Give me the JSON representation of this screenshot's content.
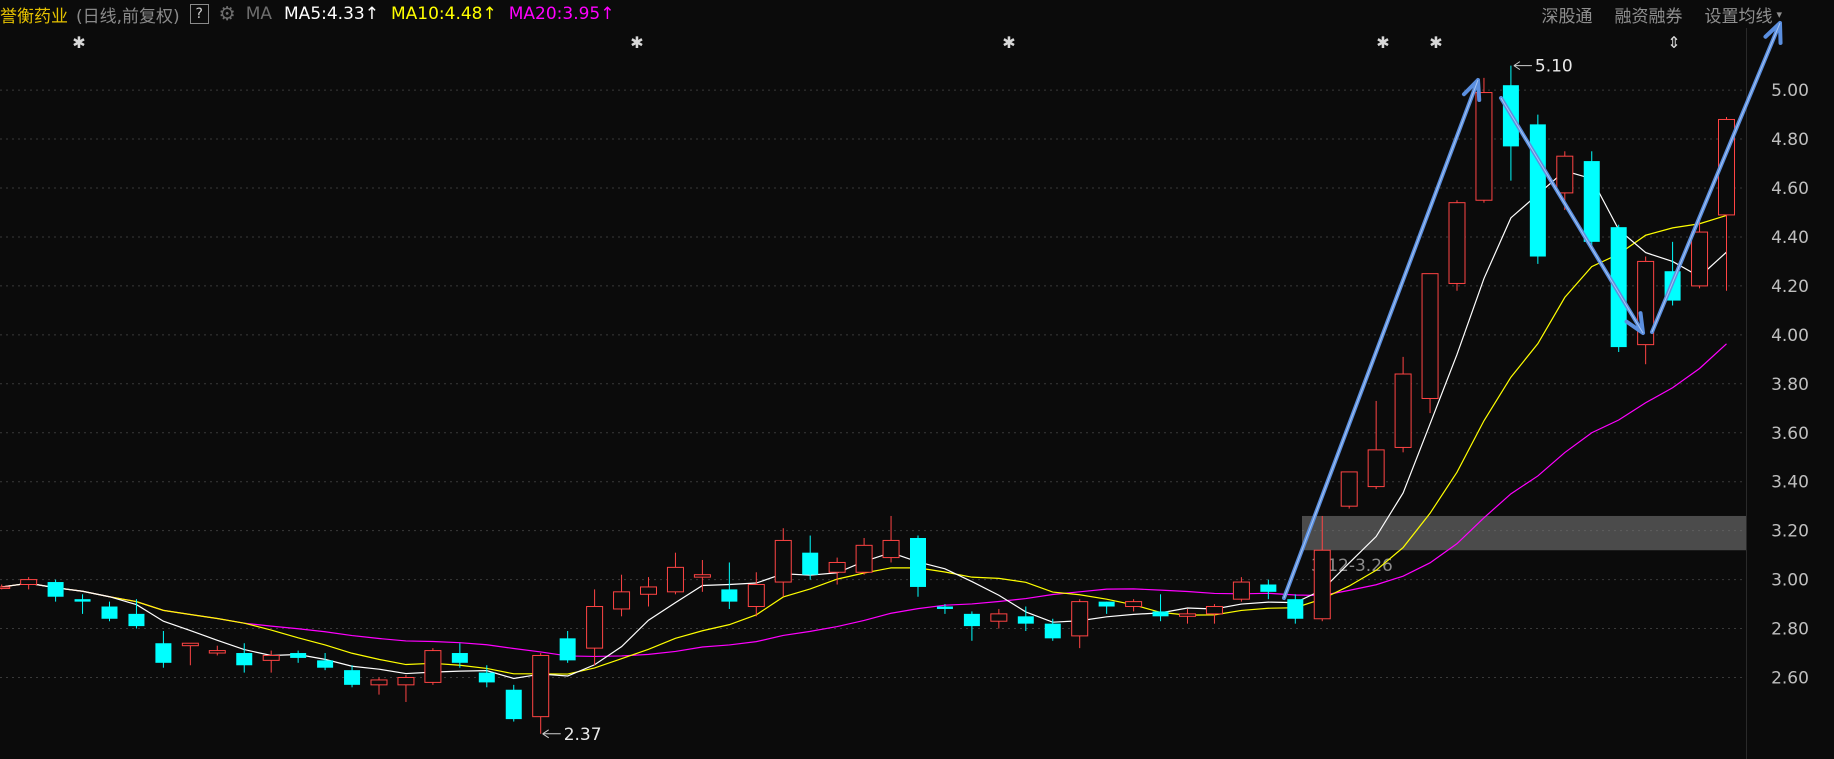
{
  "header": {
    "stock_name": "誉衡药业",
    "period_label": "(日线,前复权)",
    "help_label": "?",
    "ma_label": "MA",
    "ma5": "MA5:4.33",
    "ma10": "MA10:4.48",
    "ma20": "MA20:3.95",
    "up_arrow": "↑"
  },
  "toolbar": {
    "shenzhen_connect": "深股通",
    "margin_trading": "融资融券",
    "set_ma": "设置均线",
    "dropdown_caret": "▾"
  },
  "colors": {
    "background": "#0b0b0b",
    "up_candle": "#ff4444",
    "down_candle": "#00ffff",
    "ma5": "#ffffff",
    "ma10": "#ffff00",
    "ma20": "#ff00ff",
    "trend_arrow": "#5b8fdf",
    "zone": "#777777"
  },
  "chart_data": {
    "type": "candlestick",
    "y_ticks": [
      "5.00",
      "4.80",
      "4.60",
      "4.40",
      "4.20",
      "4.00",
      "3.80",
      "3.60",
      "3.40",
      "3.20",
      "3.00",
      "2.80",
      "2.60"
    ],
    "ylim": [
      2.37,
      5.1
    ],
    "candles": [
      [
        2.97,
        2.97,
        2.98,
        2.96
      ],
      [
        2.98,
        3.0,
        3.01,
        2.96
      ],
      [
        2.99,
        2.93,
        3.0,
        2.91
      ],
      [
        2.92,
        2.91,
        2.94,
        2.86
      ],
      [
        2.89,
        2.84,
        2.91,
        2.83
      ],
      [
        2.86,
        2.81,
        2.92,
        2.8
      ],
      [
        2.74,
        2.66,
        2.79,
        2.64
      ],
      [
        2.73,
        2.74,
        2.74,
        2.65
      ],
      [
        2.7,
        2.71,
        2.73,
        2.69
      ],
      [
        2.7,
        2.65,
        2.74,
        2.62
      ],
      [
        2.67,
        2.69,
        2.71,
        2.62
      ],
      [
        2.7,
        2.68,
        2.71,
        2.66
      ],
      [
        2.67,
        2.64,
        2.7,
        2.63
      ],
      [
        2.63,
        2.57,
        2.65,
        2.56
      ],
      [
        2.57,
        2.59,
        2.6,
        2.53
      ],
      [
        2.57,
        2.6,
        2.61,
        2.5
      ],
      [
        2.58,
        2.71,
        2.72,
        2.57
      ],
      [
        2.7,
        2.66,
        2.74,
        2.64
      ],
      [
        2.62,
        2.58,
        2.65,
        2.56
      ],
      [
        2.55,
        2.43,
        2.57,
        2.42
      ],
      [
        2.44,
        2.69,
        2.7,
        2.37
      ],
      [
        2.76,
        2.67,
        2.79,
        2.66
      ],
      [
        2.72,
        2.89,
        2.96,
        2.65
      ],
      [
        2.88,
        2.95,
        3.02,
        2.85
      ],
      [
        2.94,
        2.97,
        3.01,
        2.89
      ],
      [
        2.95,
        3.05,
        3.11,
        2.94
      ],
      [
        3.01,
        3.02,
        3.08,
        2.95
      ],
      [
        2.96,
        2.91,
        3.07,
        2.88
      ],
      [
        2.89,
        2.98,
        3.03,
        2.85
      ],
      [
        2.99,
        3.16,
        3.21,
        2.93
      ],
      [
        3.11,
        3.02,
        3.18,
        3.0
      ],
      [
        3.03,
        3.07,
        3.09,
        2.98
      ],
      [
        3.03,
        3.14,
        3.17,
        3.02
      ],
      [
        3.09,
        3.16,
        3.26,
        3.07
      ],
      [
        3.17,
        2.97,
        3.18,
        2.93
      ],
      [
        2.89,
        2.88,
        2.9,
        2.86
      ],
      [
        2.86,
        2.81,
        2.87,
        2.75
      ],
      [
        2.83,
        2.86,
        2.88,
        2.8
      ],
      [
        2.85,
        2.82,
        2.89,
        2.79
      ],
      [
        2.82,
        2.76,
        2.84,
        2.75
      ],
      [
        2.77,
        2.91,
        2.92,
        2.72
      ],
      [
        2.91,
        2.89,
        2.91,
        2.86
      ],
      [
        2.89,
        2.91,
        2.92,
        2.87
      ],
      [
        2.87,
        2.85,
        2.94,
        2.83
      ],
      [
        2.85,
        2.86,
        2.88,
        2.82
      ],
      [
        2.86,
        2.89,
        2.9,
        2.82
      ],
      [
        2.92,
        2.99,
        3.01,
        2.91
      ],
      [
        2.98,
        2.95,
        3.0,
        2.92
      ],
      [
        2.92,
        2.84,
        2.94,
        2.82
      ],
      [
        2.84,
        3.12,
        3.26,
        2.83
      ],
      [
        3.3,
        3.44,
        3.44,
        3.29
      ],
      [
        3.38,
        3.53,
        3.73,
        3.37
      ],
      [
        3.54,
        3.84,
        3.91,
        3.52
      ],
      [
        3.74,
        4.25,
        4.25,
        3.68
      ],
      [
        4.21,
        4.54,
        4.55,
        4.18
      ],
      [
        4.55,
        4.99,
        5.05,
        4.54
      ],
      [
        5.02,
        4.77,
        5.1,
        4.63
      ],
      [
        4.86,
        4.32,
        4.9,
        4.29
      ],
      [
        4.58,
        4.73,
        4.75,
        4.51
      ],
      [
        4.71,
        4.38,
        4.75,
        4.35
      ],
      [
        4.44,
        3.95,
        4.45,
        3.93
      ],
      [
        3.96,
        4.3,
        4.32,
        3.88
      ],
      [
        4.26,
        4.14,
        4.38,
        4.12
      ],
      [
        4.2,
        4.42,
        4.49,
        4.19
      ],
      [
        4.49,
        4.88,
        4.89,
        4.18
      ]
    ],
    "price_labels": {
      "high": "5.10",
      "low": "2.37",
      "zone": "3.12-3.26"
    },
    "zone_range": [
      3.12,
      3.26
    ],
    "marker_glyphs": [
      "✱",
      "✱",
      "✱",
      "✱",
      "✱",
      "⇕"
    ]
  }
}
